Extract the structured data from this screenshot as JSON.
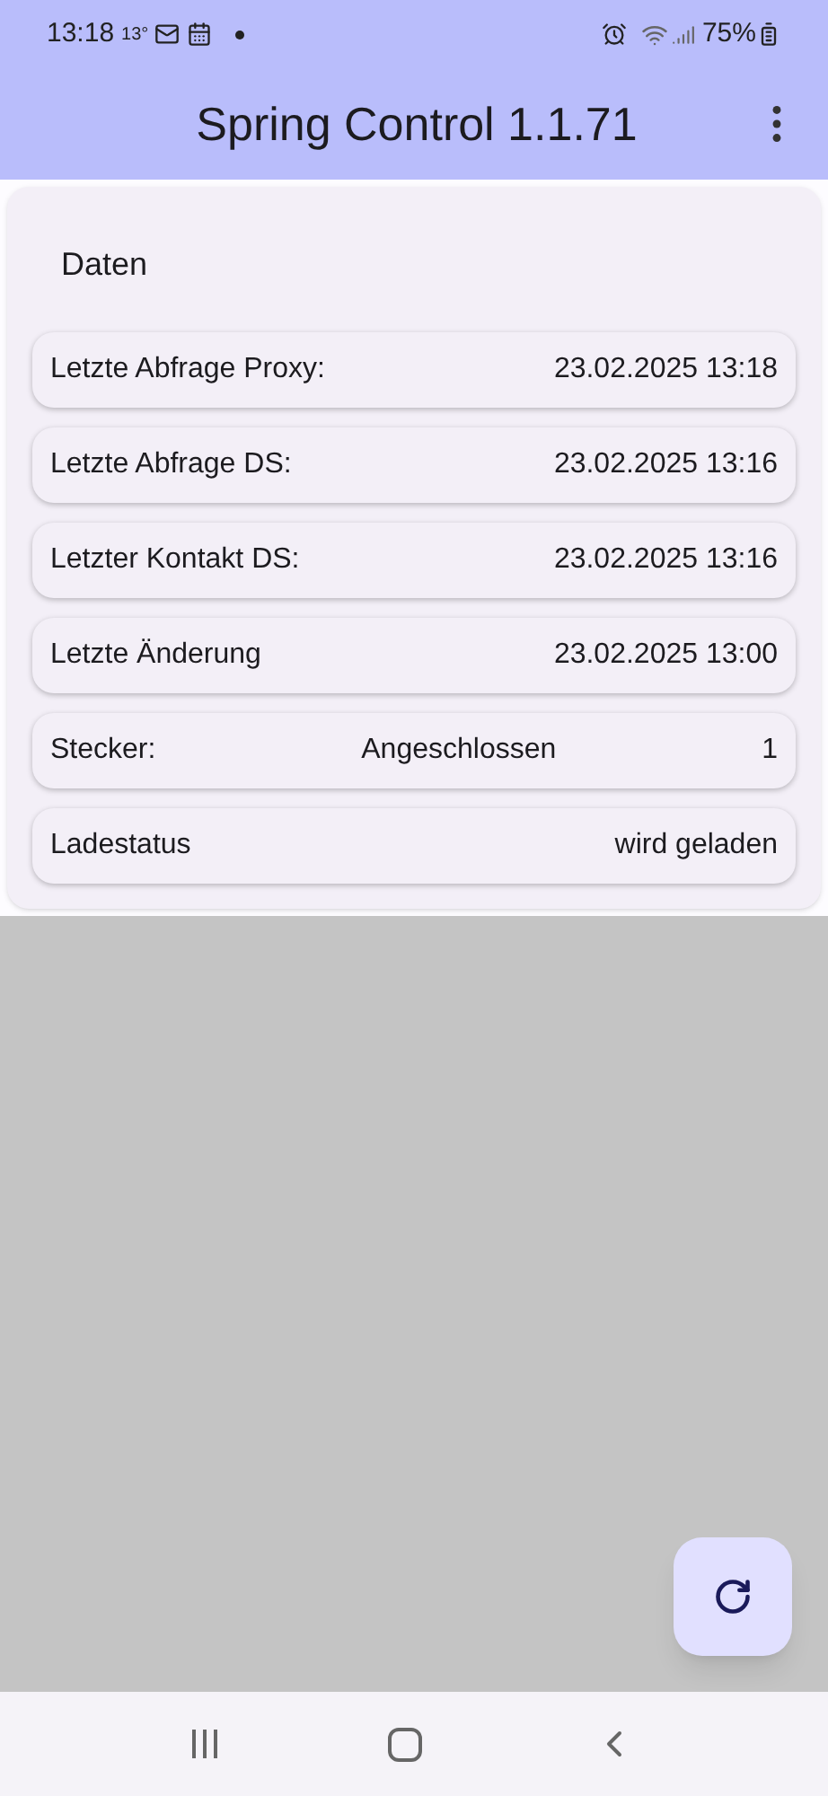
{
  "status_bar": {
    "time": "13:18",
    "temperature": "13°",
    "battery": "75%"
  },
  "app_bar": {
    "title": "Spring Control 1.1.71"
  },
  "card": {
    "title": "Daten",
    "rows": [
      {
        "cells": [
          "Letzte Abfrage Proxy:",
          "23.02.2025 13:18"
        ]
      },
      {
        "cells": [
          "Letzte Abfrage DS:",
          "23.02.2025 13:16"
        ]
      },
      {
        "cells": [
          "Letzter Kontakt DS:",
          "23.02.2025 13:16"
        ]
      },
      {
        "cells": [
          "Letzte Änderung",
          "23.02.2025 13:00"
        ]
      },
      {
        "cells": [
          "Stecker:",
          "Angeschlossen",
          "1"
        ]
      },
      {
        "cells": [
          "Ladestatus",
          "wird geladen"
        ]
      }
    ]
  }
}
